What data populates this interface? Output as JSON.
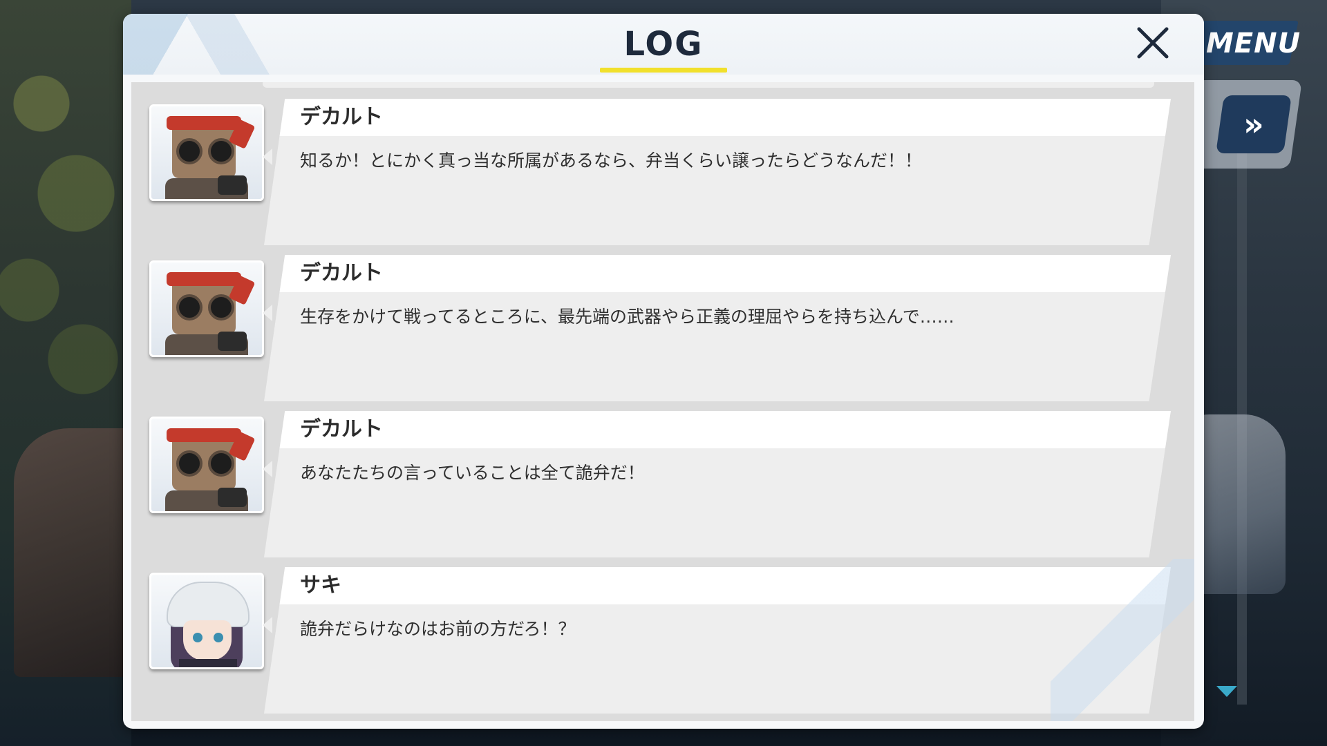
{
  "modal": {
    "title": "LOG",
    "close_icon": "close-icon",
    "accent_color": "#f1e02b"
  },
  "side_controls": {
    "menu_label": "MENU",
    "fast_forward_label": "»",
    "scroll_indicator_icon": "triangle-down-icon"
  },
  "log": {
    "entries": [
      {
        "speaker": "デカルト",
        "text": "知るか！とにかく真っ当な所属があるなら、弁当くらい譲ったらどうなんだ！！",
        "avatar": "robot-avatar"
      },
      {
        "speaker": "デカルト",
        "text": "生存をかけて戦ってるところに、最先端の武器やら正義の理屈やらを持ち込んで……",
        "avatar": "robot-avatar"
      },
      {
        "speaker": "デカルト",
        "text": "あなたたちの言っていることは全て詭弁だ！",
        "avatar": "robot-avatar"
      },
      {
        "speaker": "サキ",
        "text": "詭弁だらけなのはお前の方だろ！？",
        "avatar": "girl-avatar"
      }
    ]
  }
}
